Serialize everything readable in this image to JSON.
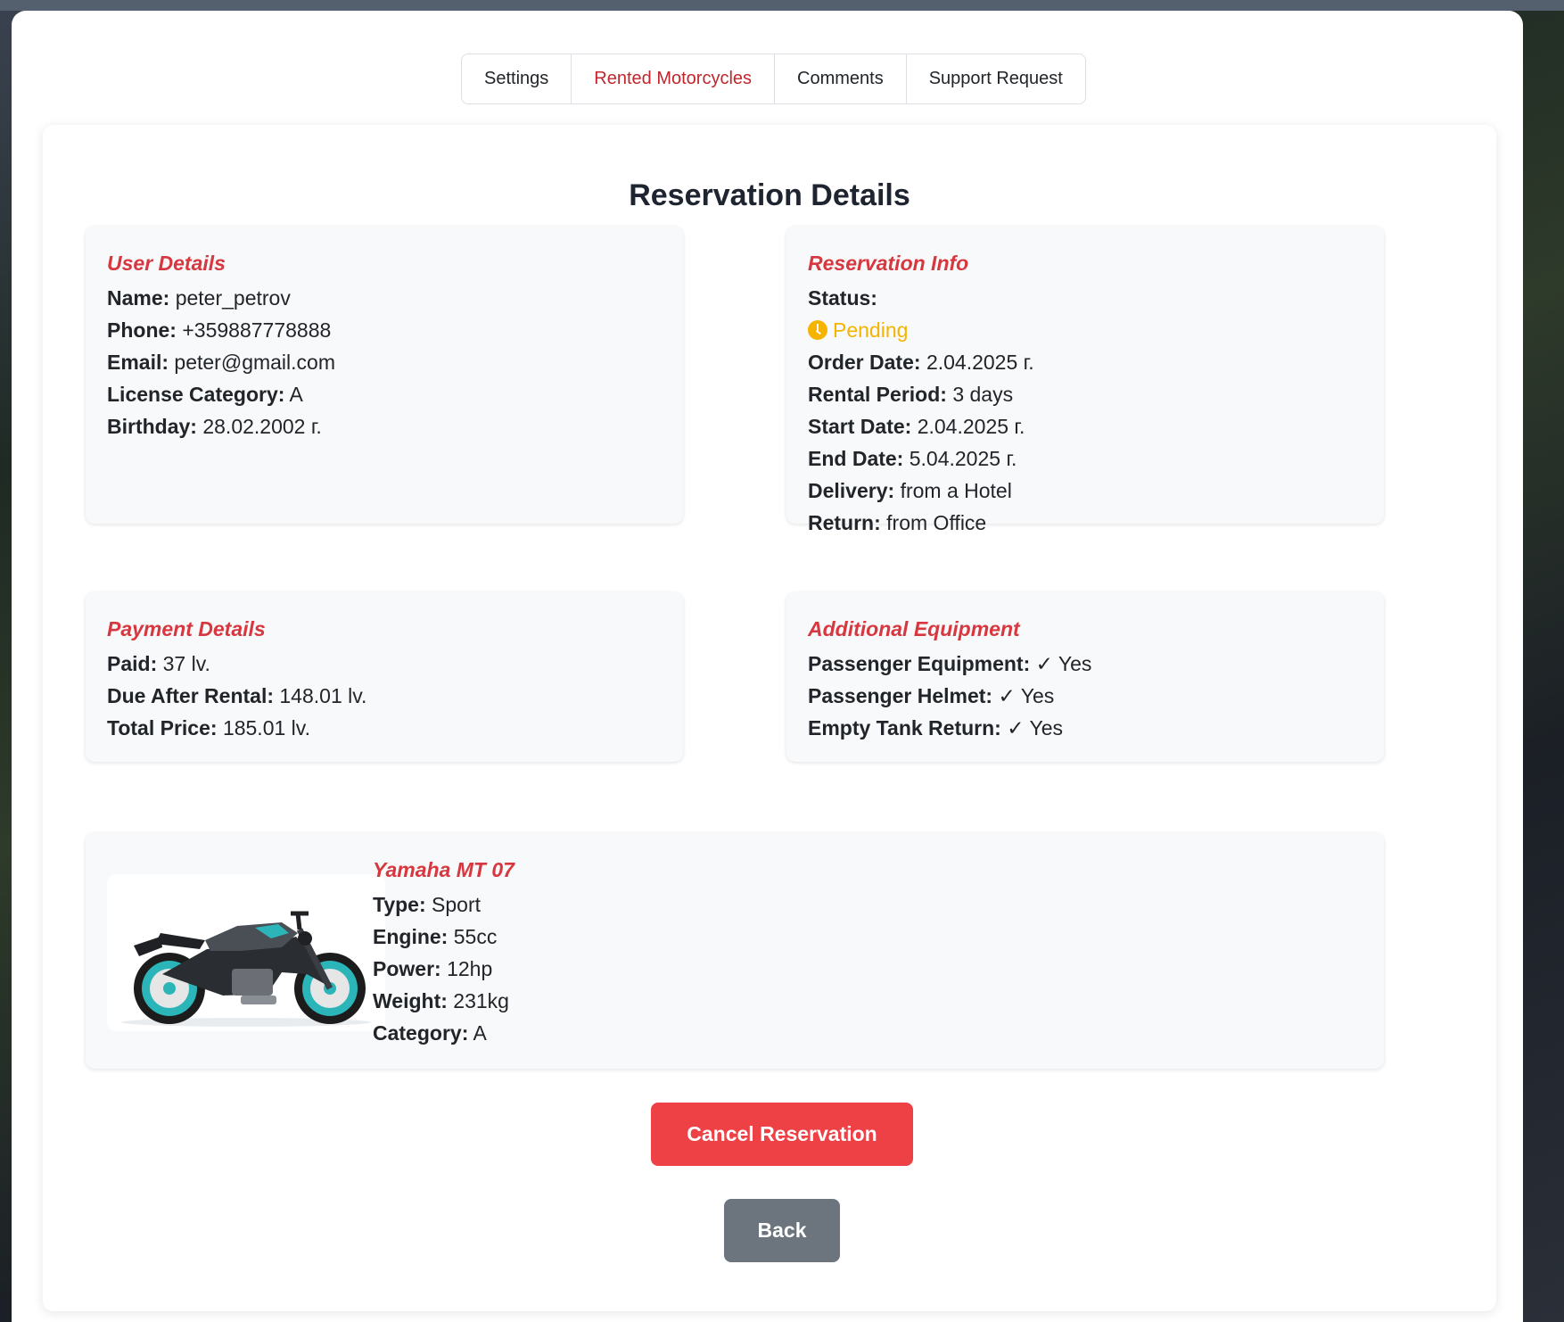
{
  "tabs": [
    {
      "label": "Settings"
    },
    {
      "label": "Rented Motorcycles"
    },
    {
      "label": "Comments"
    },
    {
      "label": "Support Request"
    }
  ],
  "page_title": "Reservation Details",
  "user_details": {
    "heading": "User Details",
    "rows": [
      {
        "label": "Name:",
        "value": "peter_petrov"
      },
      {
        "label": "Phone:",
        "value": "+359887778888"
      },
      {
        "label": "Email:",
        "value": "peter@gmail.com"
      },
      {
        "label": "License Category:",
        "value": "A"
      },
      {
        "label": "Birthday:",
        "value": "28.02.2002 г."
      }
    ]
  },
  "reservation_info": {
    "heading": "Reservation Info",
    "status_label": "Status:",
    "status_value": "Pending",
    "rows": [
      {
        "label": "Order Date:",
        "value": "2.04.2025 г."
      },
      {
        "label": "Rental Period:",
        "value": "3 days"
      },
      {
        "label": "Start Date:",
        "value": "2.04.2025 г."
      },
      {
        "label": "End Date:",
        "value": "5.04.2025 г."
      },
      {
        "label": "Delivery:",
        "value": "from a Hotel"
      },
      {
        "label": "Return:",
        "value": "from Office"
      }
    ]
  },
  "payment_details": {
    "heading": "Payment Details",
    "rows": [
      {
        "label": "Paid:",
        "value": "37 lv."
      },
      {
        "label": "Due After Rental:",
        "value": "148.01 lv."
      },
      {
        "label": "Total Price:",
        "value": "185.01 lv."
      }
    ]
  },
  "additional_equipment": {
    "heading": "Additional Equipment",
    "rows": [
      {
        "label": "Passenger Equipment:",
        "value": "✓ Yes"
      },
      {
        "label": "Passenger Helmet:",
        "value": "✓ Yes"
      },
      {
        "label": "Empty Tank Return:",
        "value": "✓ Yes"
      }
    ]
  },
  "motorcycle": {
    "name": "Yamaha MT 07",
    "rows": [
      {
        "label": "Type:",
        "value": "Sport"
      },
      {
        "label": "Engine:",
        "value": "55cc"
      },
      {
        "label": "Power:",
        "value": "12hp"
      },
      {
        "label": "Weight:",
        "value": "231kg"
      },
      {
        "label": "Category:",
        "value": "A"
      }
    ]
  },
  "buttons": {
    "cancel_label": "Cancel Reservation",
    "back_label": "Back"
  },
  "colors": {
    "accent_red": "#d7373f",
    "status_pending": "#f4b400",
    "cancel_button": "#ee4146",
    "back_button": "#6c757d"
  }
}
